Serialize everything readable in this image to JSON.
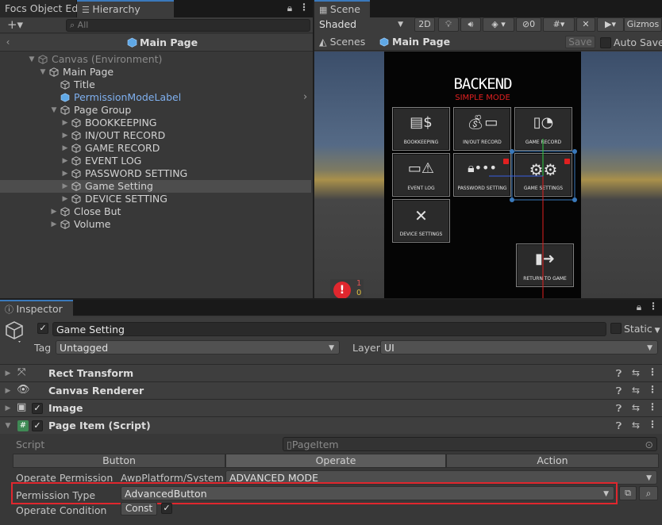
{
  "tabs_left": {
    "tab1": "Focs Object Editor",
    "tab2": "Hierarchy"
  },
  "hierarchy": {
    "search_placeholder": "All",
    "header": "Main Page",
    "items": [
      {
        "label": "Canvas (Environment)"
      },
      {
        "label": "Main Page"
      },
      {
        "label": "Title"
      },
      {
        "label": "PermissionModeLabel"
      },
      {
        "label": "Page Group"
      },
      {
        "label": "BOOKKEEPING"
      },
      {
        "label": "IN/OUT RECORD"
      },
      {
        "label": "GAME RECORD"
      },
      {
        "label": "EVENT LOG"
      },
      {
        "label": "PASSWORD SETTING"
      },
      {
        "label": "Game Setting"
      },
      {
        "label": "DEVICE SETTING"
      },
      {
        "label": "Close But"
      },
      {
        "label": "Volume"
      }
    ]
  },
  "scene": {
    "tab": "Scene",
    "shading": "Shaded",
    "btn_2d": "2D",
    "hidden_count": "0",
    "gizmos": "Gizmos",
    "breadcrumb_root": "Scenes",
    "breadcrumb_current": "Main Page",
    "save": "Save",
    "auto_save": "Auto Save",
    "canvas_title": "BACKEND",
    "canvas_subtitle": "SIMPLE MODE",
    "buttons": [
      {
        "label": "BOOKKEEPING"
      },
      {
        "label": "IN/OUT RECORD"
      },
      {
        "label": "GAME RECORD"
      },
      {
        "label": "EVENT LOG"
      },
      {
        "label": "PASSWORD SETTING"
      },
      {
        "label": "GAME SETTINGS"
      },
      {
        "label": "DEVICE SETTINGS"
      },
      {
        "label": "RETURN TO GAME"
      }
    ],
    "error_count": "1",
    "warn_count": "0"
  },
  "inspector": {
    "tab": "Inspector",
    "object_name": "Game Setting",
    "static_label": "Static",
    "tag_label": "Tag",
    "tag_value": "Untagged",
    "layer_label": "Layer",
    "layer_value": "UI",
    "components": [
      {
        "title": "Rect Transform"
      },
      {
        "title": "Canvas Renderer"
      },
      {
        "title": "Image"
      },
      {
        "title": "Page Item (Script)"
      }
    ],
    "script_label": "Script",
    "script_value": "PageItem",
    "segment_tabs": [
      "Button",
      "Operate",
      "Action"
    ],
    "operate_permission_label": "Operate Permission",
    "operate_permission_type": "AwpPlatform/SystemPa",
    "operate_permission_value": "ADVANCED MODE",
    "permission_type_label": "Permission Type",
    "permission_type_value": "AdvancedButton",
    "operate_condition_label": "Operate Condition",
    "operate_condition_value": "Const"
  },
  "colors": {
    "highlight_box": "#e0272e",
    "selection_blue": "#3a79bb",
    "label_blue": "#7fb0ef",
    "subtitle_red": "#e02020"
  }
}
